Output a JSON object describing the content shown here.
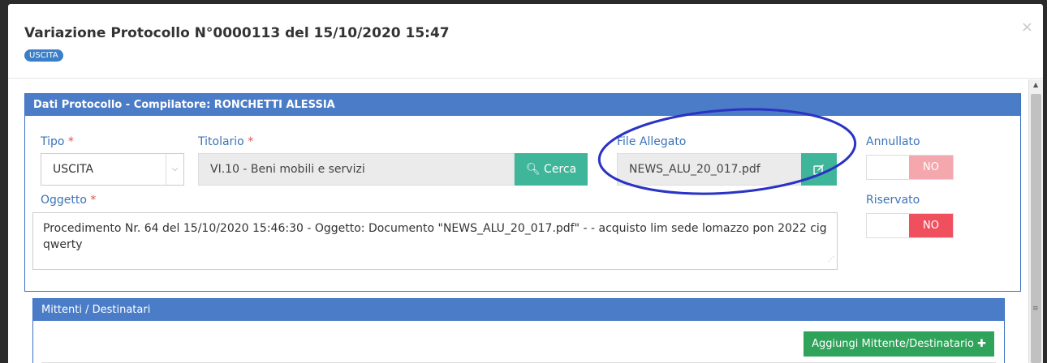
{
  "modal": {
    "title": "Variazione Protocollo N°0000113 del 15/10/2020 15:47",
    "badge": "USCITA",
    "close_symbol": "×"
  },
  "panel": {
    "heading": "Dati Protocollo - Compilatore: RONCHETTI ALESSIA"
  },
  "fields": {
    "tipo": {
      "label": "Tipo",
      "value": "USCITA"
    },
    "titolario": {
      "label": "Titolario",
      "value": "VI.10 - Beni mobili e servizi",
      "button": "Cerca"
    },
    "file_allegato": {
      "label": "File Allegato",
      "value": "NEWS_ALU_20_017.pdf"
    },
    "annullato": {
      "label": "Annullato",
      "value": "NO"
    },
    "riservato": {
      "label": "Riservato",
      "value": "NO"
    },
    "oggetto": {
      "label": "Oggetto",
      "value": "Procedimento Nr. 64 del 15/10/2020 15:46:30 - Oggetto: Documento \"NEWS_ALU_20_017.pdf\" -  - acquisto lim sede lomazzo pon 2022 cig qwerty"
    },
    "required_mark": "*"
  },
  "recipients": {
    "heading": "Mittenti / Destinatari",
    "add_button": "Aggiungi Mittente/Destinatario"
  },
  "colors": {
    "panel_heading": "#4a7cc7",
    "teal_button": "#3fb59a",
    "toggle_no_light": "#f4a7ad",
    "toggle_no_strong": "#f0505e",
    "annotation_ellipse": "#2a33c4"
  }
}
